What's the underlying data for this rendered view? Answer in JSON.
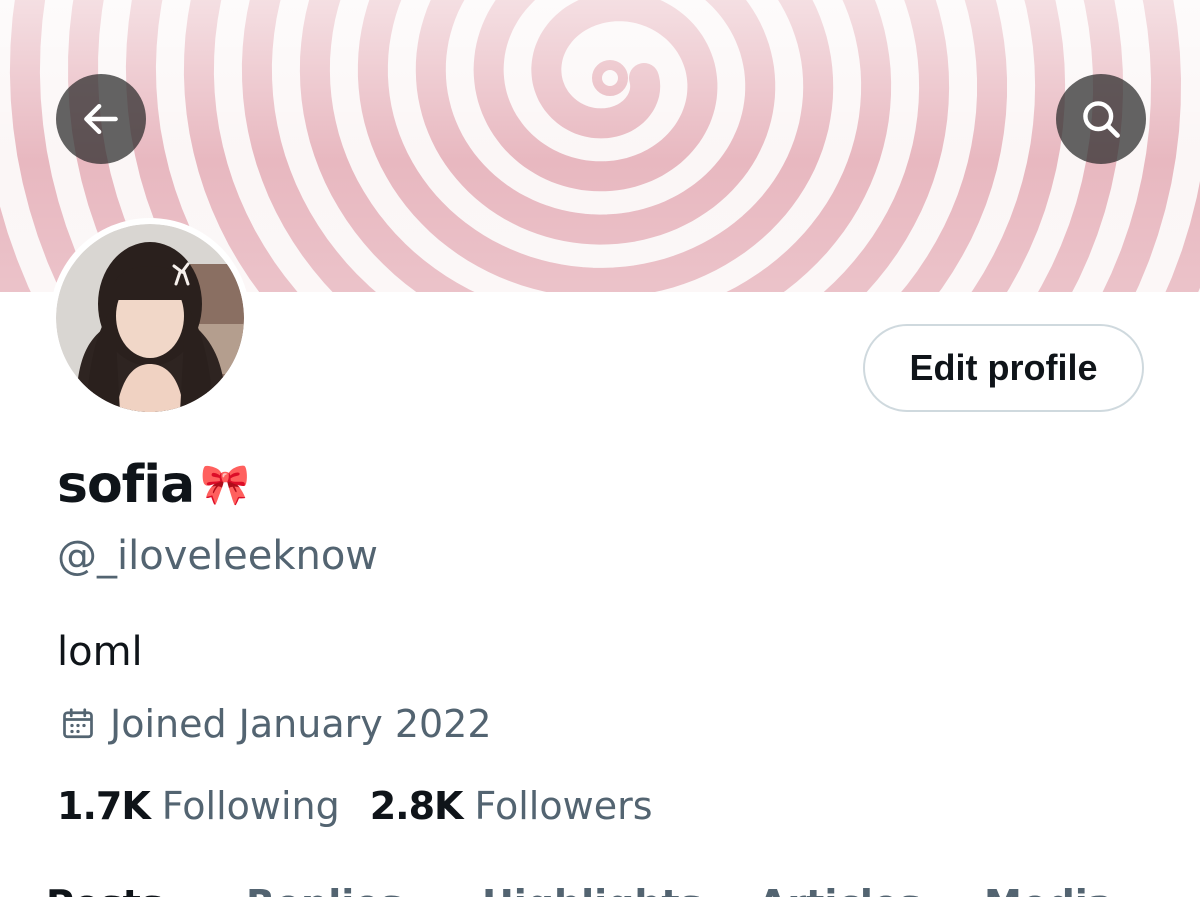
{
  "header": {
    "back_icon": "arrow-left-icon",
    "search_icon": "search-icon",
    "banner_pattern": "pink-spiral",
    "banner_color": "#e8b8c0"
  },
  "profile": {
    "display_name": "sofia",
    "name_emoji": "🎀",
    "handle": "@_iloveleeknow",
    "bio": "loml",
    "joined_icon": "calendar-icon",
    "joined": "Joined January 2022",
    "edit_button": "Edit profile"
  },
  "stats": {
    "following_count": "1.7K",
    "following_label": "Following",
    "followers_count": "2.8K",
    "followers_label": "Followers"
  },
  "tabs": [
    {
      "label": "Posts"
    },
    {
      "label": "Replies"
    },
    {
      "label": "Highlights"
    },
    {
      "label": "Articles"
    },
    {
      "label": "Media"
    }
  ],
  "colors": {
    "primary_text": "#0f1419",
    "secondary_text": "#536471",
    "border": "#cfd9de"
  }
}
